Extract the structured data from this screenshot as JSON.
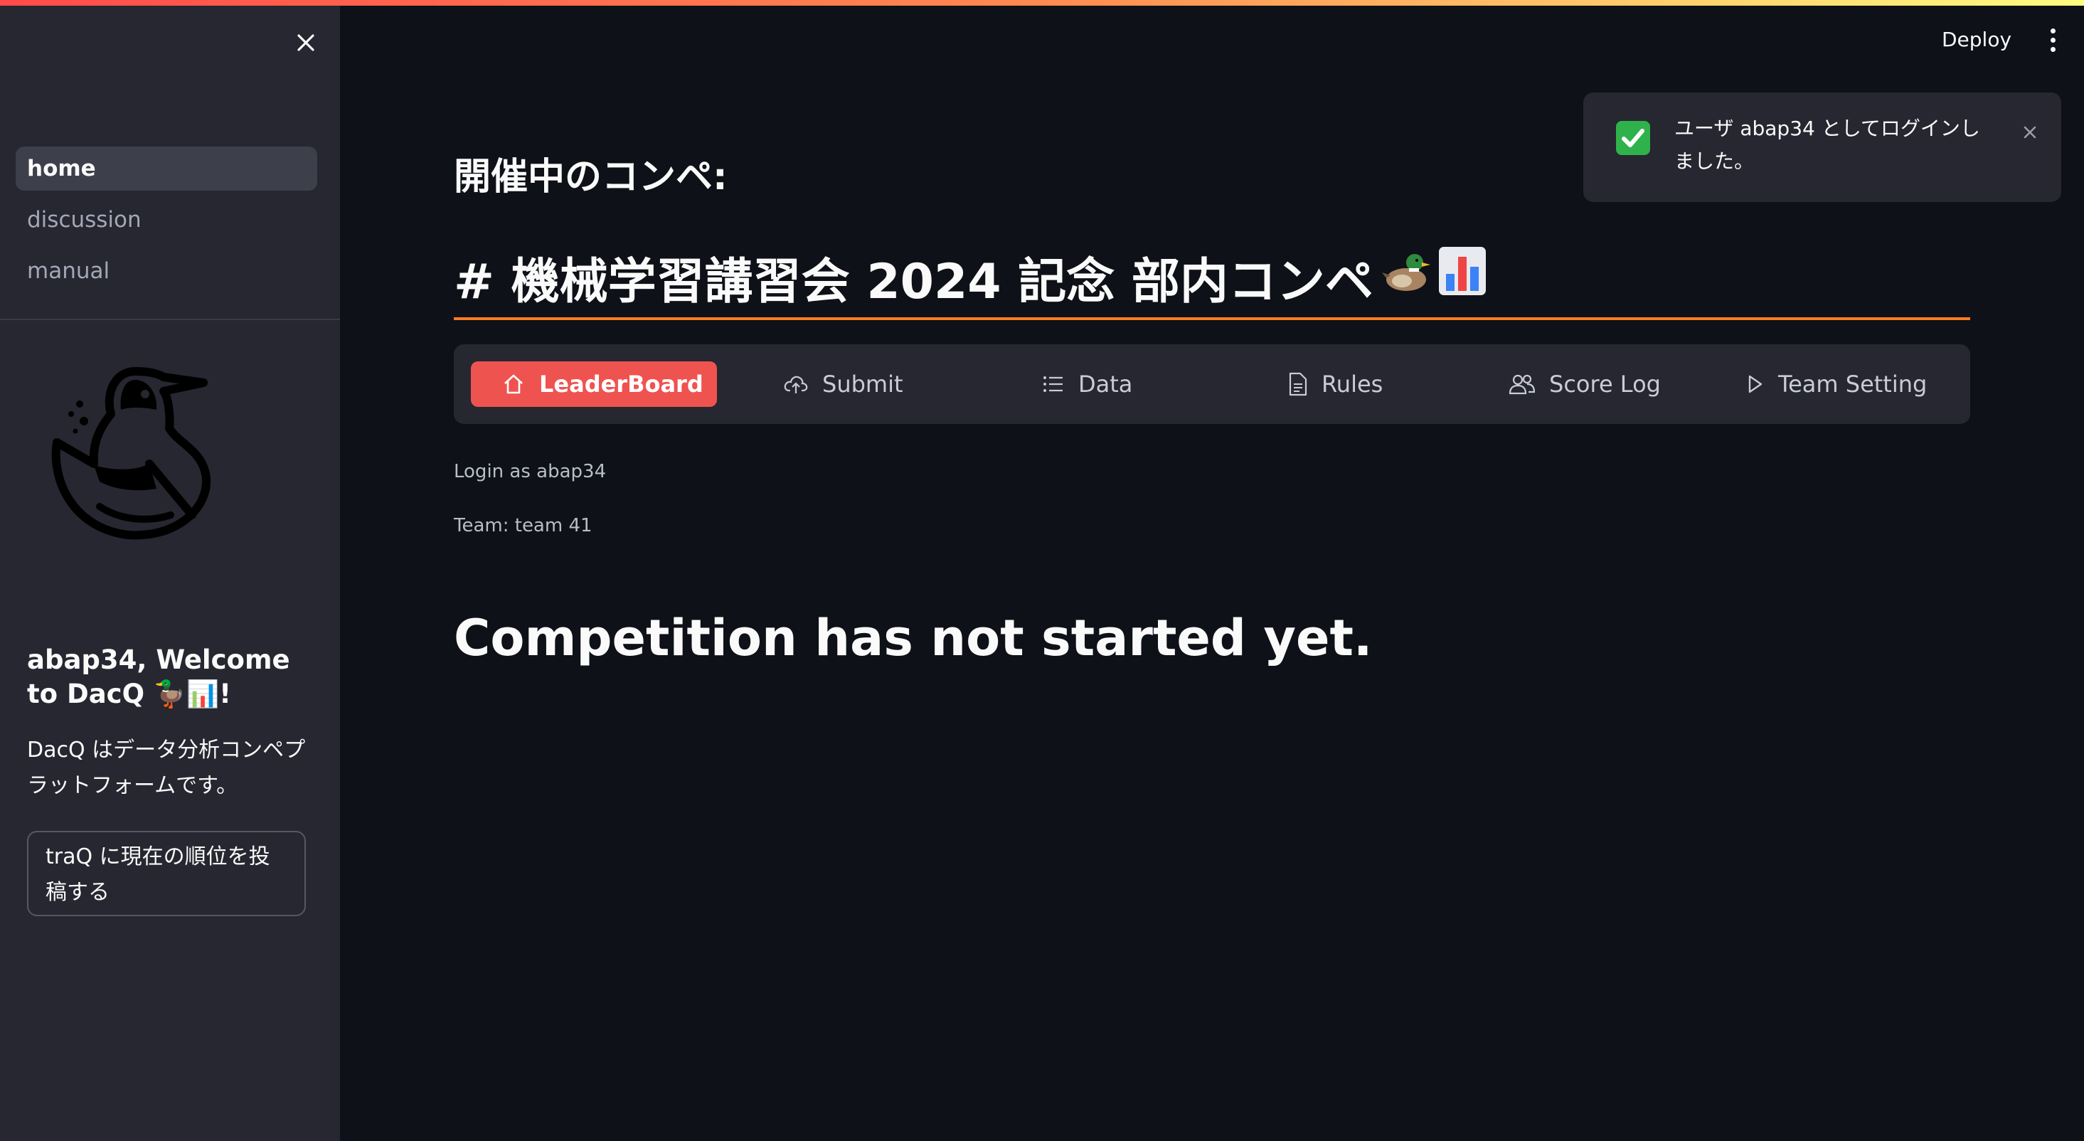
{
  "header": {
    "deploy_label": "Deploy"
  },
  "sidebar": {
    "nav": [
      {
        "label": "home",
        "active": true
      },
      {
        "label": "discussion",
        "active": false
      },
      {
        "label": "manual",
        "active": false
      }
    ],
    "welcome": "abap34, Welcome to DacQ 🦆📊!",
    "description": "DacQ はデータ分析コンペプラットフォームです。",
    "post_button": "traQ に現在の順位を投稿する"
  },
  "toast": {
    "message": "ユーザ abap34 としてログインしました。"
  },
  "main": {
    "subtitle": "開催中のコンペ:",
    "title": "# 機械学習講習会 2024 記念 部内コンペ",
    "tabs": [
      {
        "label": "LeaderBoard",
        "icon": "home-icon",
        "active": true
      },
      {
        "label": "Submit",
        "icon": "cloud-upload-icon",
        "active": false
      },
      {
        "label": "Data",
        "icon": "list-icon",
        "active": false
      },
      {
        "label": "Rules",
        "icon": "document-icon",
        "active": false
      },
      {
        "label": "Score Log",
        "icon": "people-icon",
        "active": false
      },
      {
        "label": "Team Setting",
        "icon": "play-icon",
        "active": false
      }
    ],
    "login_text": "Login as abap34",
    "team_text": "Team: team 41",
    "status_text": "Competition has not started yet."
  },
  "colors": {
    "background": "#0e1117",
    "sidebar": "#262730",
    "accent": "#ef5350",
    "rule": "#ff7b23",
    "success": "#2fb24b"
  }
}
